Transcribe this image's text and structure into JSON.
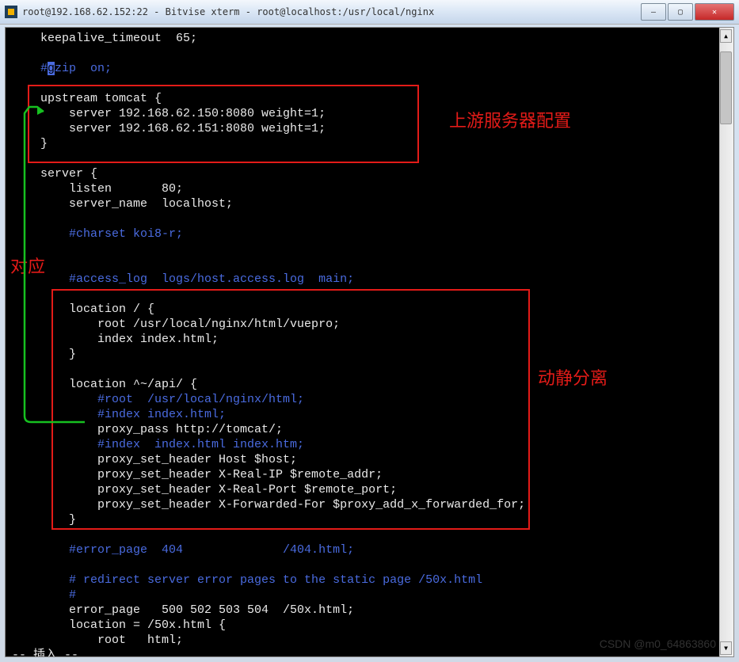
{
  "window": {
    "title": "root@192.168.62.152:22 - Bitvise xterm - root@localhost:/usr/local/nginx"
  },
  "winbtns": {
    "min": "—",
    "max": "▢",
    "close": "✕"
  },
  "scroll": {
    "up": "▲",
    "down": "▼"
  },
  "term": {
    "l1": "    keepalive_timeout  65;",
    "l2": "",
    "l3a": "    #",
    "l3cursor": "g",
    "l3b": "zip  on;",
    "l4": "",
    "l5": "    upstream tomcat {",
    "l6": "        server 192.168.62.150:8080 weight=1;",
    "l7": "        server 192.168.62.151:8080 weight=1;",
    "l8": "    }",
    "l9": "",
    "l10": "    server {",
    "l11": "        listen       80;",
    "l12": "        server_name  localhost;",
    "l13": "",
    "l14": "        #charset koi8-r;",
    "l15": "",
    "l16": "",
    "l17": "        #access_log  logs/host.access.log  main;",
    "l18": "",
    "l19": "        location / {",
    "l20": "            root /usr/local/nginx/html/vuepro;",
    "l21": "            index index.html;",
    "l22": "        }",
    "l23": "",
    "l24": "        location ^~/api/ {",
    "l25": "            #root  /usr/local/nginx/html;",
    "l26": "            #index index.html;",
    "l27": "            proxy_pass http://tomcat/;",
    "l28": "            #index  index.html index.htm;",
    "l29": "            proxy_set_header Host $host;",
    "l30": "            proxy_set_header X-Real-IP $remote_addr;",
    "l31": "            proxy_set_header X-Real-Port $remote_port;",
    "l32": "            proxy_set_header X-Forwarded-For $proxy_add_x_forwarded_for;",
    "l33": "        }",
    "l34": "",
    "l35": "        #error_page  404              /404.html;",
    "l36": "",
    "l37": "        # redirect server error pages to the static page /50x.html",
    "l38": "        #",
    "l39": "        error_page   500 502 503 504  /50x.html;",
    "l40": "        location = /50x.html {",
    "l41": "            root   html;",
    "status": "-- 插入 --"
  },
  "anno": {
    "upstream_label": "上游服务器配置",
    "correspond_label": "对应",
    "split_label": "动静分离"
  },
  "watermark": "CSDN @m0_64863860"
}
